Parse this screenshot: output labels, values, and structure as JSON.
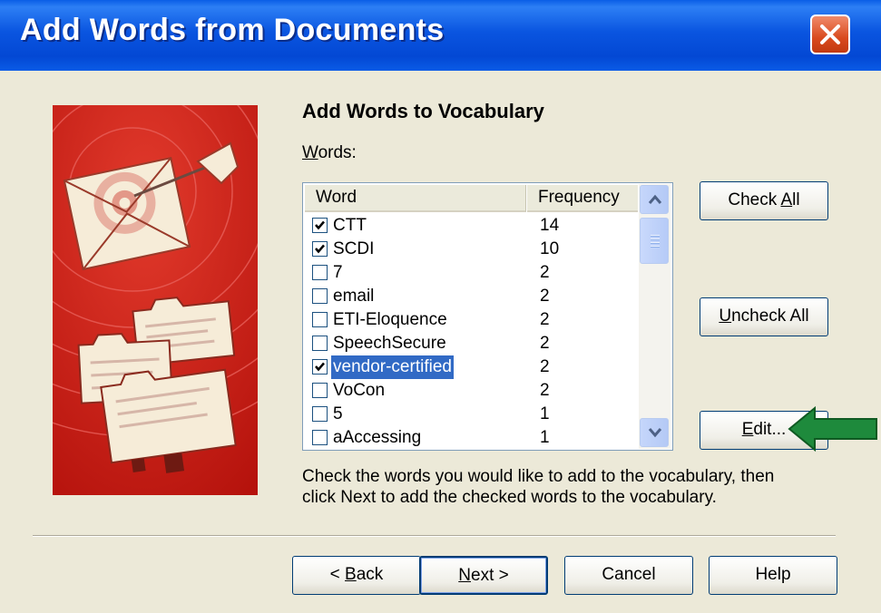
{
  "window": {
    "title": "Add Words from Documents",
    "close_icon": "close-x-icon",
    "accent_color": "#0a55e0"
  },
  "content": {
    "heading": "Add Words to Vocabulary",
    "words_label": "Words:",
    "help_text": "Check the words you would like to add to the vocabulary, then click Next to add the checked words to the vocabulary."
  },
  "list": {
    "columns": [
      "Word",
      "Frequency"
    ],
    "rows": [
      {
        "word": "CTT",
        "frequency": "14",
        "checked": true,
        "selected": false
      },
      {
        "word": "SCDI",
        "frequency": "10",
        "checked": true,
        "selected": false
      },
      {
        "word": "7",
        "frequency": "2",
        "checked": false,
        "selected": false
      },
      {
        "word": "email",
        "frequency": "2",
        "checked": false,
        "selected": false
      },
      {
        "word": "ETI-Eloquence",
        "frequency": "2",
        "checked": false,
        "selected": false
      },
      {
        "word": "SpeechSecure",
        "frequency": "2",
        "checked": false,
        "selected": false
      },
      {
        "word": "vendor-certified",
        "frequency": "2",
        "checked": true,
        "selected": true
      },
      {
        "word": "VoCon",
        "frequency": "2",
        "checked": false,
        "selected": false
      },
      {
        "word": "5",
        "frequency": "1",
        "checked": false,
        "selected": false
      },
      {
        "word": "aAccessing",
        "frequency": "1",
        "checked": false,
        "selected": false
      }
    ]
  },
  "side_buttons": {
    "check_all": "Check All",
    "uncheck_all": "Uncheck All",
    "edit": "Edit..."
  },
  "footer_buttons": {
    "back": "< Back",
    "next": "Next >",
    "cancel": "Cancel",
    "help": "Help"
  },
  "annotation": {
    "arrow_icon": "green-arrow-icon",
    "arrow_color": "#1e8a3c"
  }
}
